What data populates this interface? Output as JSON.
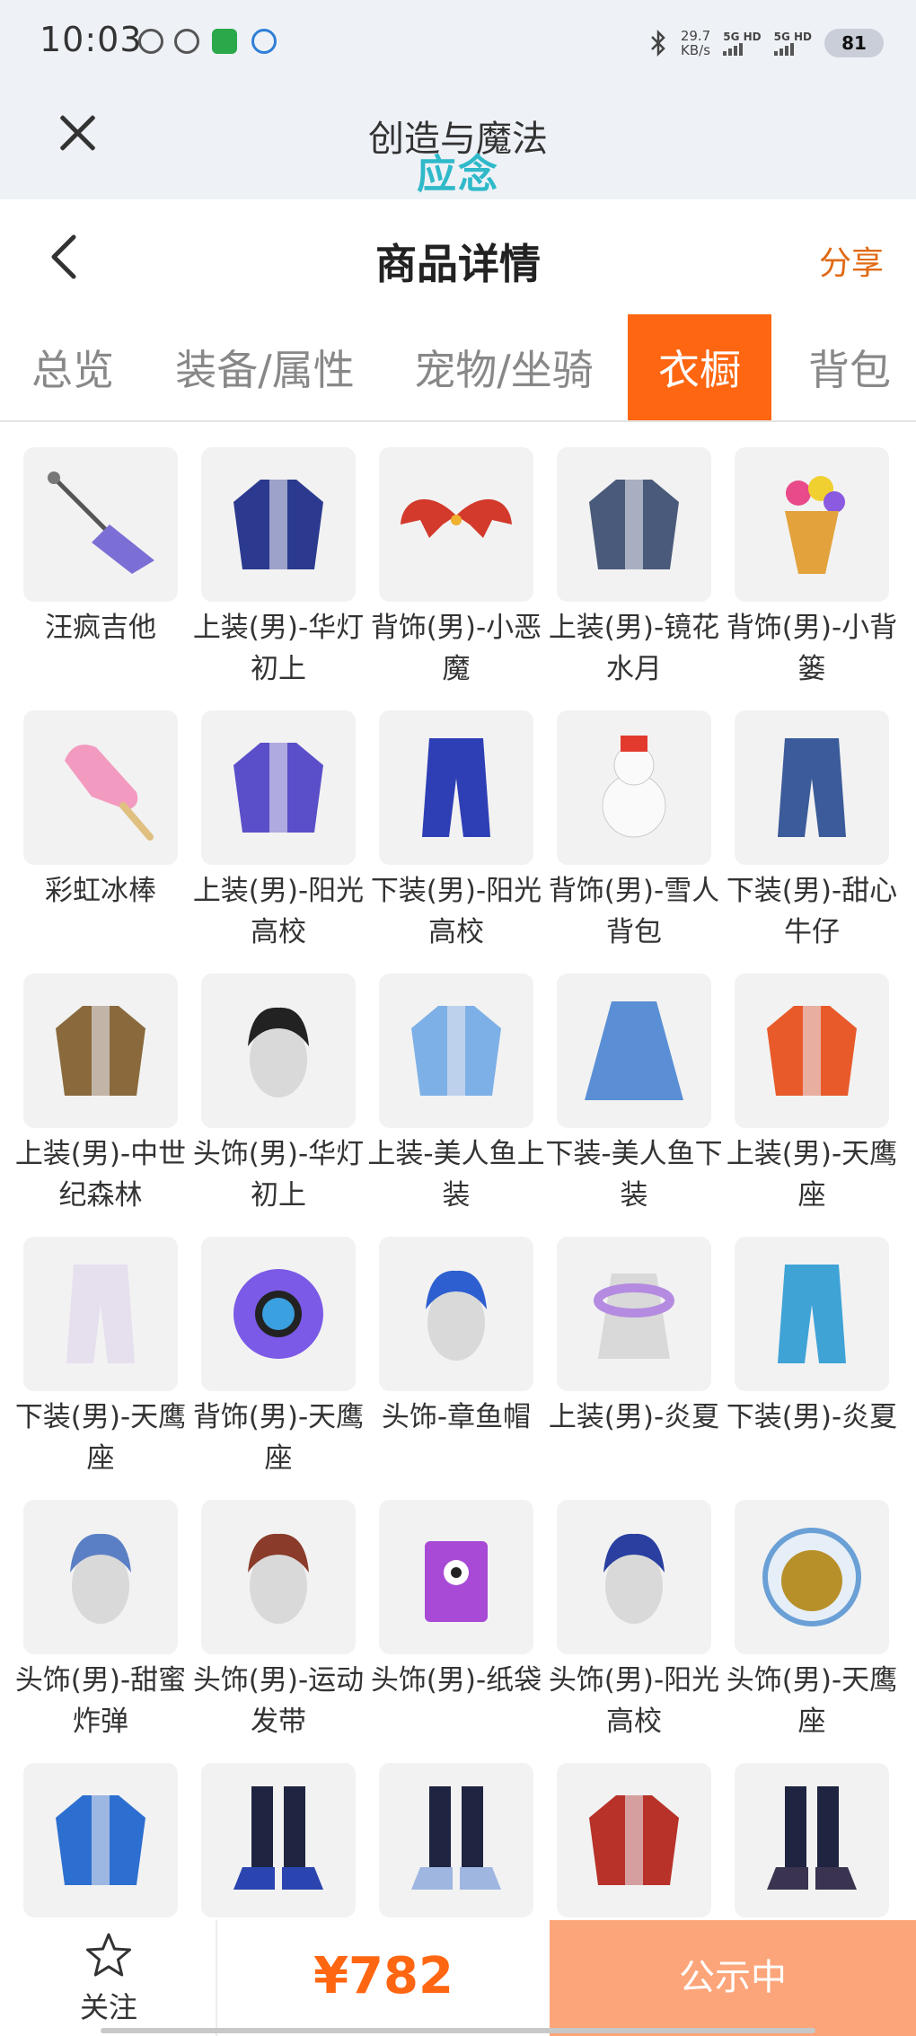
{
  "status_bar": {
    "time": "10:03",
    "net_speed_value": "29.7",
    "net_speed_unit": "KB/s",
    "net1": "5G HD",
    "net2": "5G HD",
    "battery": "81"
  },
  "app_header": {
    "title": "创造与魔法",
    "subtitle": "应念"
  },
  "page_header": {
    "title": "商品详情",
    "share_label": "分享"
  },
  "tabs": [
    {
      "label": "总览",
      "active": false
    },
    {
      "label": "装备/属性",
      "active": false
    },
    {
      "label": "宠物/坐骑",
      "active": false
    },
    {
      "label": "衣橱",
      "active": true
    },
    {
      "label": "背包",
      "active": false
    }
  ],
  "items": [
    {
      "name": "汪疯吉他",
      "icon": "guitar-icon",
      "color": "#7b6fd6"
    },
    {
      "name": "上装(男)-华灯初上",
      "icon": "coat-icon",
      "color": "#2b3a8f"
    },
    {
      "name": "背饰(男)-小恶魔",
      "icon": "wings-icon",
      "color": "#d33a2c"
    },
    {
      "name": "上装(男)-镜花水月",
      "icon": "coat-icon",
      "color": "#4a5a7a"
    },
    {
      "name": "背饰(男)-小背篓",
      "icon": "basket-icon",
      "color": "#e3a23c"
    },
    {
      "name": "彩虹冰棒",
      "icon": "popsicle-icon",
      "color": "#f39ac0"
    },
    {
      "name": "上装(男)-阳光高校",
      "icon": "coat-icon",
      "color": "#5a4fc9"
    },
    {
      "name": "下装(男)-阳光高校",
      "icon": "pants-icon",
      "color": "#2e3fb5"
    },
    {
      "name": "背饰(男)-雪人背包",
      "icon": "snowman-icon",
      "color": "#e23b2e"
    },
    {
      "name": "下装(男)-甜心牛仔",
      "icon": "pants-icon",
      "color": "#3b5b9a"
    },
    {
      "name": "上装(男)-中世纪森林",
      "icon": "coat-icon",
      "color": "#8a6a3c"
    },
    {
      "name": "头饰(男)-华灯初上",
      "icon": "head-icon",
      "color": "#222222"
    },
    {
      "name": "上装-美人鱼上装",
      "icon": "coat-icon",
      "color": "#7db0e6"
    },
    {
      "name": "下装-美人鱼下装",
      "icon": "skirt-icon",
      "color": "#5a8fd6"
    },
    {
      "name": "上装(男)-天鹰座",
      "icon": "coat-icon",
      "color": "#e85a2a"
    },
    {
      "name": "下装(男)-天鹰座",
      "icon": "pants-icon",
      "color": "#e6dfee"
    },
    {
      "name": "背饰(男)-天鹰座",
      "icon": "orb-icon",
      "color": "#7a5ae6"
    },
    {
      "name": "头饰-章鱼帽",
      "icon": "head-icon",
      "color": "#2d5fd0"
    },
    {
      "name": "上装(男)-炎夏",
      "icon": "torso-icon",
      "color": "#b48be0"
    },
    {
      "name": "下装(男)-炎夏",
      "icon": "pants-icon",
      "color": "#3fa3d6"
    },
    {
      "name": "头饰(男)-甜蜜炸弹",
      "icon": "head-icon",
      "color": "#5b7fc4"
    },
    {
      "name": "头饰(男)-运动发带",
      "icon": "head-icon",
      "color": "#8a3b2a"
    },
    {
      "name": "头饰(男)-纸袋",
      "icon": "bag-icon",
      "color": "#a84ad6"
    },
    {
      "name": "头饰(男)-阳光高校",
      "icon": "head-icon",
      "color": "#2a3fa0"
    },
    {
      "name": "头饰(男)-天鹰座",
      "icon": "helmet-icon",
      "color": "#b8902a"
    },
    {
      "name": "",
      "icon": "coat-icon",
      "color": "#2d6fd0"
    },
    {
      "name": "",
      "icon": "shoes-icon",
      "color": "#2a44b0"
    },
    {
      "name": "",
      "icon": "shoes-icon",
      "color": "#9fb6e0"
    },
    {
      "name": "",
      "icon": "coat-icon",
      "color": "#b8322a"
    },
    {
      "name": "",
      "icon": "shoes-icon",
      "color": "#3a3450"
    }
  ],
  "bottom_bar": {
    "follow_label": "关注",
    "price": "¥782",
    "status_label": "公示中"
  },
  "colors": {
    "accent": "#ff6611",
    "share": "#e06a16",
    "status_button": "#fda57a",
    "subtitle": "#2fb9c9"
  }
}
